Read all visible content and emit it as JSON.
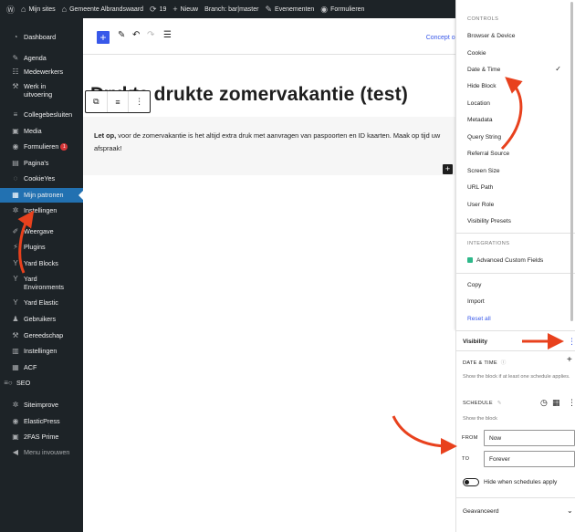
{
  "admin_bar": {
    "items": [
      {
        "icon": "wordpress-icon",
        "label": ""
      },
      {
        "icon": "sites-icon",
        "label": "Mijn sites"
      },
      {
        "icon": "home-icon",
        "label": "Gemeente Albrandswaard"
      },
      {
        "icon": "updates-icon",
        "label": "19"
      },
      {
        "icon": "plus-icon",
        "label": "Nieuw"
      },
      {
        "icon": "",
        "label": "Branch: bar|master"
      },
      {
        "icon": "events-icon",
        "label": "Evenementen"
      },
      {
        "icon": "forms-icon",
        "label": "Formulieren"
      }
    ]
  },
  "sidebar": {
    "items": [
      {
        "icon": "dashboard-icon",
        "label": "Dashboard"
      },
      {
        "icon": "agenda-icon",
        "label": "Agenda"
      },
      {
        "icon": "users-group-icon",
        "label": "Medewerkers"
      },
      {
        "icon": "wrench-icon",
        "label": "Werk in uitvoering"
      },
      {
        "icon": "list-icon",
        "label": "Collegebesluiten"
      },
      {
        "icon": "media-icon",
        "label": "Media"
      },
      {
        "icon": "forms-icon",
        "label": "Formulieren",
        "badge": "1"
      },
      {
        "icon": "pages-icon",
        "label": "Pagina's"
      },
      {
        "icon": "cookie-icon",
        "label": "CookieYes"
      },
      {
        "icon": "patterns-icon",
        "label": "Mijn patronen",
        "active": true
      },
      {
        "icon": "settings-icon",
        "label": "Instellingen"
      },
      {
        "icon": "brush-icon",
        "label": "Weergave"
      },
      {
        "icon": "plugin-icon",
        "label": "Plugins"
      },
      {
        "icon": "yard-icon",
        "label": "Yard Blocks"
      },
      {
        "icon": "yard-icon",
        "label": "Yard Environments"
      },
      {
        "icon": "yard-icon",
        "label": "Yard Elastic"
      },
      {
        "icon": "user-icon",
        "label": "Gebruikers"
      },
      {
        "icon": "tools-icon",
        "label": "Gereedschap"
      },
      {
        "icon": "settings-panel-icon",
        "label": "Instellingen"
      },
      {
        "icon": "acf-icon",
        "label": "ACF"
      },
      {
        "icon": "seo-icon",
        "label": "SEO"
      },
      {
        "icon": "siteimprove-icon",
        "label": "Siteimprove"
      },
      {
        "icon": "elasticpress-icon",
        "label": "ElasticPress"
      },
      {
        "icon": "2fas-icon",
        "label": "2FAS Prime"
      },
      {
        "icon": "collapse-icon",
        "label": "Menu invouwen"
      }
    ]
  },
  "toolbar": {
    "draft_label": "Concept ops"
  },
  "editor": {
    "title_visible": "drukte zomervakantie (test)",
    "title_covered": "Drukte",
    "notice_bold": "Let op,",
    "notice_rest": " voor de zomervakantie is het altijd extra druk met aanvragen van paspoorten en ID kaarten. Maak op tijd uw afspraak!"
  },
  "popover": {
    "controls_heading": "CONTROLS",
    "controls": [
      "Browser & Device",
      "Cookie",
      "Date & Time",
      "Hide Block",
      "Location",
      "Metadata",
      "Query String",
      "Referral Source",
      "Screen Size",
      "URL Path",
      "User Role",
      "Visibility Presets"
    ],
    "checked_index": 2,
    "integrations_heading": "INTEGRATIONS",
    "integrations": [
      "Advanced Custom Fields"
    ],
    "actions": [
      "Copy",
      "Import"
    ],
    "reset": "Reset all"
  },
  "panel": {
    "visibility_label": "Visibility",
    "date_time_label": "DATE & TIME",
    "date_time_help": "Show the block if at least one schedule applies.",
    "schedule_label": "SCHEDULE",
    "show_block": "Show the block",
    "from_label": "FROM",
    "from_value": "Now",
    "to_label": "TO",
    "to_value": "Forever",
    "hide_toggle_label": "Hide when schedules apply",
    "advanced_label": "Geavanceerd"
  },
  "colors": {
    "sidebar_bg": "#1d2327",
    "active_bg": "#2271b1",
    "accent": "#3858e9",
    "arrow": "#e8411d"
  }
}
